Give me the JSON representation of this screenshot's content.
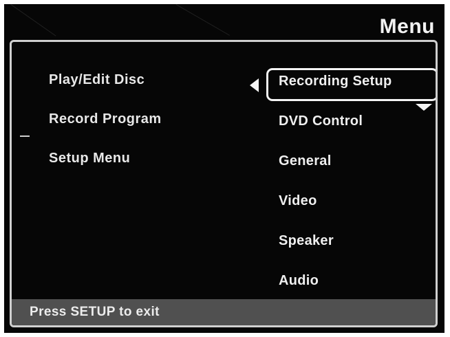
{
  "header": {
    "title": "Menu"
  },
  "left_menu": {
    "items": [
      {
        "label": "Play/Edit Disc"
      },
      {
        "label": "Record Program"
      },
      {
        "label": "Setup Menu"
      }
    ]
  },
  "right_menu": {
    "items": [
      {
        "label": "Recording Setup",
        "selected": true
      },
      {
        "label": "DVD Control"
      },
      {
        "label": "General"
      },
      {
        "label": "Video"
      },
      {
        "label": "Speaker"
      },
      {
        "label": "Audio"
      }
    ]
  },
  "status_bar": {
    "text": "Press SETUP to exit"
  },
  "icons": {
    "left_arrow": "left-arrow-icon",
    "scroll_down": "chevron-down-icon"
  },
  "colors": {
    "background": "#060606",
    "text": "#efefef",
    "status_bar": "#505050",
    "frame": "#cfcfcf"
  }
}
